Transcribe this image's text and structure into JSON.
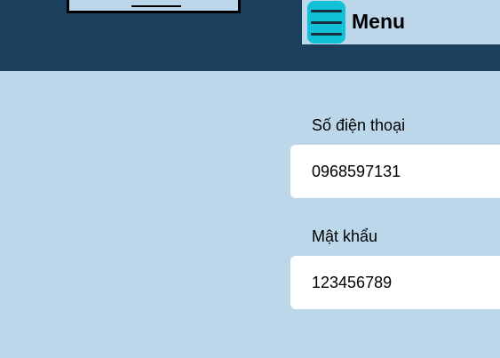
{
  "header": {
    "menu_label": "Menu"
  },
  "form": {
    "phone": {
      "label": "Số điện thoại",
      "value": "0968597131"
    },
    "password": {
      "label": "Mật khẩu",
      "value": "123456789"
    }
  },
  "colors": {
    "header_bg": "#1b405e",
    "page_bg": "#bdd7ea",
    "menu_button_bg": "#12c1d7",
    "input_bg": "#ffffff"
  }
}
